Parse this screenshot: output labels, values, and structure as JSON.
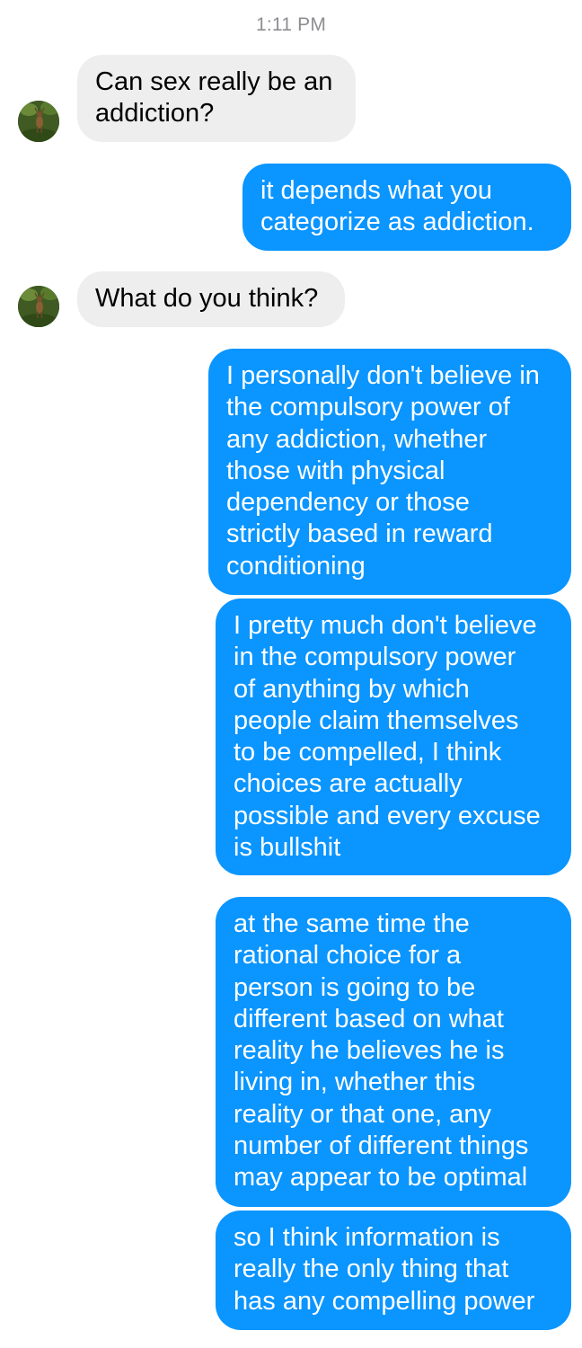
{
  "timestamp": "1:11 PM",
  "contact": {
    "avatar_icon": "deer-photo-avatar"
  },
  "colors": {
    "outgoing_bubble": "#0a95ff",
    "incoming_bubble": "#eeeeee",
    "timestamp_text": "#8e8e93"
  },
  "messages": [
    {
      "direction": "incoming",
      "text": "Can sex really be an\naddiction?"
    },
    {
      "direction": "outgoing",
      "text": "it depends what you\ncategorize as addiction."
    },
    {
      "direction": "incoming",
      "text": "What do you think?"
    },
    {
      "direction": "outgoing",
      "text": "I personally don't believe in\nthe compulsory power of\nany addiction, whether\nthose with physical\ndependency or those\nstrictly based in reward\nconditioning"
    },
    {
      "direction": "outgoing",
      "text": "I pretty much don't believe\nin the compulsory power\nof anything by which\npeople claim themselves\nto be compelled, I think\nchoices are actually\npossible and every excuse\nis bullshit"
    },
    {
      "direction": "outgoing",
      "text": "at the same time the\nrational choice for a\nperson is going to be\ndifferent based on what\nreality he believes he is\nliving in, whether this\nreality or that one, any\nnumber of different things\nmay appear to be optimal"
    },
    {
      "direction": "outgoing",
      "text": "so I think information is\nreally the only thing that\nhas any compelling power"
    }
  ]
}
